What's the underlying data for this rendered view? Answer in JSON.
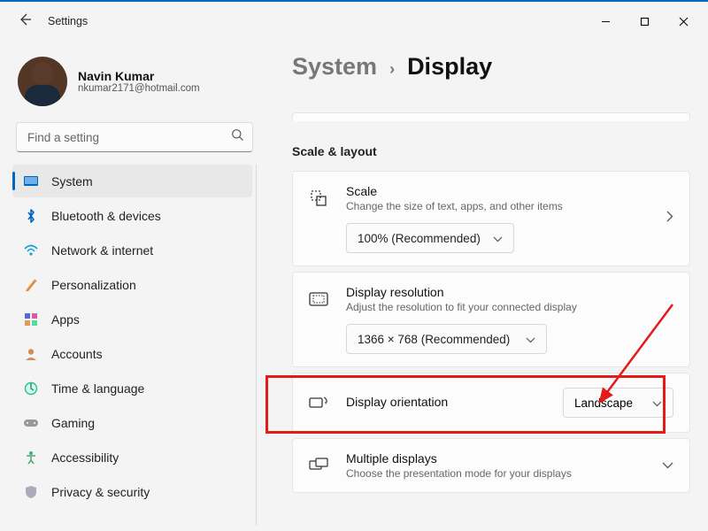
{
  "app": {
    "title": "Settings"
  },
  "user": {
    "name": "Navin Kumar",
    "email": "nkumar2171@hotmail.com"
  },
  "search": {
    "placeholder": "Find a setting"
  },
  "nav": {
    "items": [
      {
        "label": "System"
      },
      {
        "label": "Bluetooth & devices"
      },
      {
        "label": "Network & internet"
      },
      {
        "label": "Personalization"
      },
      {
        "label": "Apps"
      },
      {
        "label": "Accounts"
      },
      {
        "label": "Time & language"
      },
      {
        "label": "Gaming"
      },
      {
        "label": "Accessibility"
      },
      {
        "label": "Privacy & security"
      }
    ]
  },
  "breadcrumb": {
    "parent": "System",
    "current": "Display"
  },
  "section": {
    "title": "Scale & layout"
  },
  "scale": {
    "title": "Scale",
    "subtitle": "Change the size of text, apps, and other items",
    "value": "100% (Recommended)"
  },
  "resolution": {
    "title": "Display resolution",
    "subtitle": "Adjust the resolution to fit your connected display",
    "value": "1366 × 768 (Recommended)"
  },
  "orientation": {
    "title": "Display orientation",
    "value": "Landscape"
  },
  "multiple": {
    "title": "Multiple displays",
    "subtitle": "Choose the presentation mode for your displays"
  }
}
